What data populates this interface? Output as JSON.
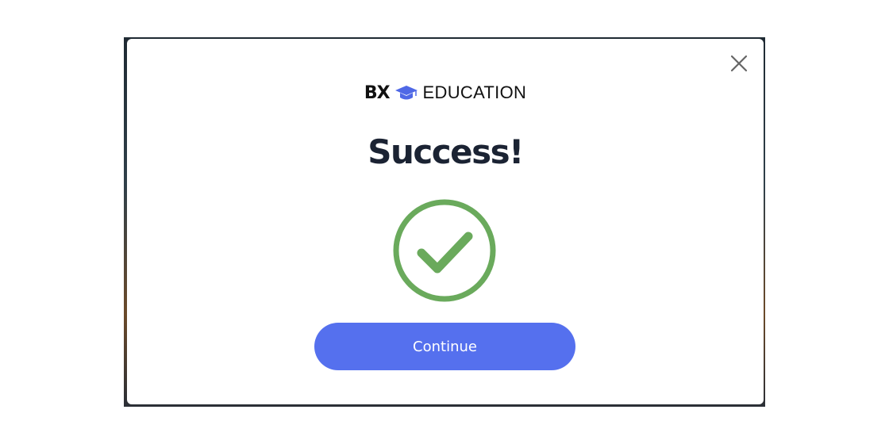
{
  "brand": {
    "prefix": "BX",
    "suffix": "EDUCATION",
    "icon": "graduation-cap-icon"
  },
  "dialog": {
    "title": "Success!",
    "status_icon": "checkmark-circle-icon",
    "close_icon": "close-icon",
    "continue_label": "Continue"
  },
  "colors": {
    "accent": "#5570ee",
    "success": "#6aaa5c",
    "title": "#1b2333",
    "brand_cap": "#4f68e6"
  }
}
